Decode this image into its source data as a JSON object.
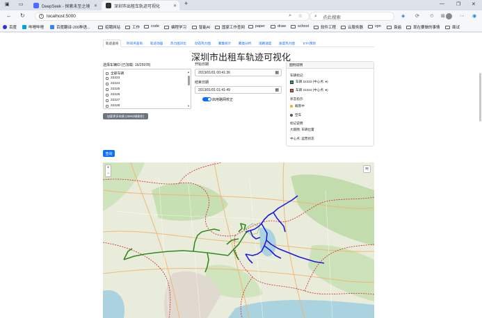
{
  "browser": {
    "tabs": [
      {
        "title": "DeepSeek - 探索未至之境"
      },
      {
        "title": "深圳市出租车轨迹可视化"
      }
    ],
    "new_tab_glyph": "+",
    "url": "localhost:5000",
    "search_placeholder": "点此搜索",
    "bookmarks": [
      "百度",
      "哔哩哔哩",
      "百度翻译-200种语...",
      "招聘网站",
      "工作",
      "code",
      "编程学习",
      "智能AI",
      "国家工作查网",
      "paper",
      "draw",
      "school",
      "软件工程",
      "云服务器",
      "vpn",
      "衰遍",
      "现在要做的事情",
      "面试"
    ]
  },
  "nav": {
    "tabs": [
      "轨迹查询",
      "时间点查询",
      "轨迹动画",
      "热力图对比",
      "动态热力图",
      "聚集统计",
      "聚类分析",
      "道路速度",
      "速度热力图",
      "ETA预测"
    ],
    "active_index": 0
  },
  "page_title": "深圳市出租车轨迹可视化",
  "vehicles": {
    "label": "选择车辆ID (已加载: 16/25978)",
    "items": [
      "全部车辆",
      "22223",
      "22224",
      "22225",
      "22226",
      "22227",
      "22228"
    ],
    "load_more": "加载更多车辆 (25962辆剩余)"
  },
  "time": {
    "start_label": "开始日期",
    "start_value": "2013/01/01 00:41:36",
    "end_label": "结束日期",
    "end_value": "2013/01/01 01:41:49",
    "toggle_label": "启用路网校正"
  },
  "legend": {
    "header": "图例说明",
    "vehicle_title": "车辆标记:",
    "vehicles": [
      {
        "text": "车辆 22223 (中心点: ●)",
        "color": "#1a9c8c"
      },
      {
        "text": "车辆 22224 (中心点: ●)",
        "color": "#e05a3a"
      }
    ],
    "status_title": "状态指示:",
    "status": [
      {
        "text": "载客中",
        "color": "#f0b020"
      },
      {
        "text": "空车",
        "color": "#555555"
      }
    ],
    "marker_title": "标记说明:",
    "marker_lines": [
      "大圆圈: 车辆位置",
      "中心点: 运营状态"
    ]
  },
  "query_label": "查询",
  "map": {
    "zoom_in": "+",
    "zoom_out": "−",
    "layers_icon": "layers-icon"
  },
  "colors": {
    "primary": "#0d6efd",
    "secondary": "#6c757d",
    "track_blue": "#1a1adf",
    "track_green": "#2e8b1e",
    "boundary_red": "#d32020"
  }
}
